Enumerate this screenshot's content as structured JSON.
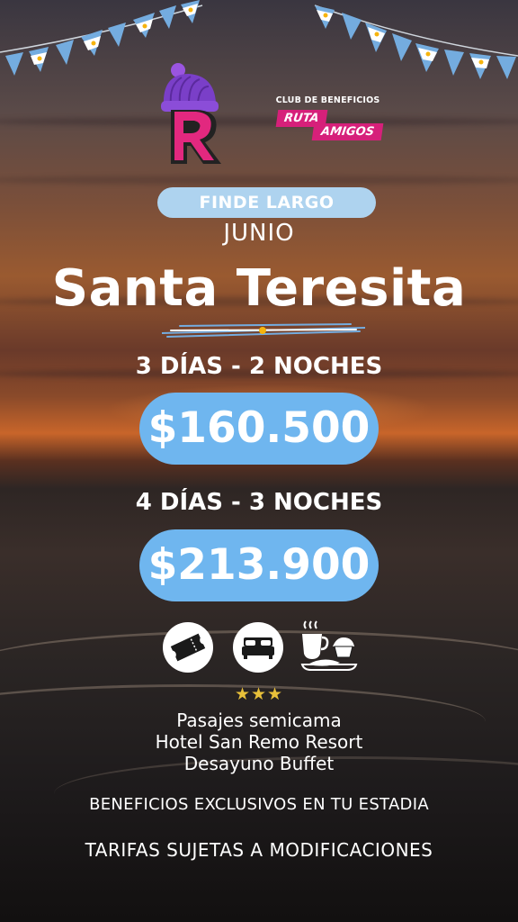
{
  "brand": {
    "logo_letter": "R",
    "club_title": "CLUB DE BENEFICIOS",
    "club_name_1": "RUTA",
    "club_name_2": "AMIGOS",
    "pink": "#d6207a",
    "purple": "#7a3fc8"
  },
  "promo": {
    "badge": "FINDE LARGO",
    "month": "JUNIO",
    "destination": "Santa Teresita"
  },
  "packages": [
    {
      "label": "3 DÍAS - 2 NOCHES",
      "price": "$160.500"
    },
    {
      "label": "4 DÍAS - 3 NOCHES",
      "price": "$213.900"
    }
  ],
  "includes": {
    "icons": [
      "ticket-icon",
      "bed-icon",
      "breakfast-icon"
    ],
    "stars": "★★★",
    "hotel_rating": 3,
    "items": [
      "Pasajes semicama",
      "Hotel San Remo Resort",
      "Desayuno Buffet"
    ]
  },
  "footer": {
    "benefits": "BENEFICIOS EXCLUSIVOS EN TU ESTADIA",
    "disclaimer": "TARIFAS SUJETAS A MODIFICACIONES"
  },
  "colors": {
    "price_pill": "#6fb6ef",
    "badge_pill": "#aed3ef",
    "flag_blue": "#74acdf",
    "sun_yellow": "#f6b40e"
  }
}
